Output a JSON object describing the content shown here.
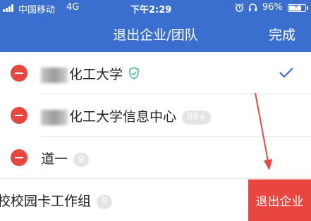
{
  "status_bar": {
    "carrier": "中国移动",
    "network": "4G",
    "time": "下午2:29",
    "battery_percent": "96%"
  },
  "nav": {
    "title": "退出企业/团队",
    "done_label": "完成"
  },
  "rows": [
    {
      "label_visible": "化工大学",
      "verified": true,
      "checked": true
    },
    {
      "label_visible": "化工大学信息中心",
      "badge": "99+"
    },
    {
      "label": "道一",
      "badge": "9"
    }
  ],
  "swiped_row": {
    "label": "校校园卡工作组",
    "badge": "9",
    "action_label": "退出企业"
  },
  "colors": {
    "brand_blue": "#3a6fd0",
    "danger_red": "#e8463f",
    "verified_green": "#3cbf7f"
  }
}
